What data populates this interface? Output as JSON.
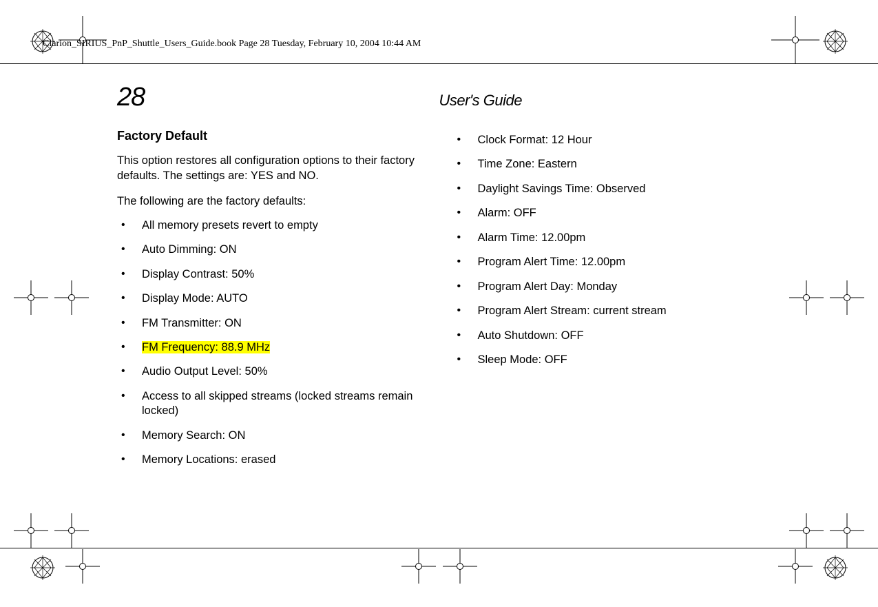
{
  "frame_path": "Clarion_SIRIUS_PnP_Shuttle_Users_Guide.book  Page 28  Tuesday, February 10, 2004  10:44 AM",
  "page_number": "28",
  "header_title": "User's Guide",
  "section_heading": "Factory Default",
  "paragraph_1": "This option restores all configuration options to their factory defaults. The settings are: YES and NO.",
  "paragraph_2": "The following are the factory defaults:",
  "left_list": [
    "All memory presets revert to empty",
    "Auto Dimming: ON",
    "Display Contrast: 50%",
    "Display Mode: AUTO",
    "FM Transmitter: ON",
    "FM Frequency: 88.9 MHz",
    "Audio Output Level: 50%",
    "Access to all skipped streams (locked streams remain locked)",
    "Memory Search: ON",
    "Memory Locations: erased"
  ],
  "right_list": [
    "Clock Format: 12 Hour",
    "Time Zone: Eastern",
    "Daylight Savings Time: Observed",
    "Alarm: OFF",
    "Alarm Time: 12.00pm",
    "Program Alert Time: 12.00pm",
    "Program Alert Day: Monday",
    "Program Alert Stream: current stream",
    "Auto Shutdown: OFF",
    "Sleep Mode: OFF"
  ],
  "highlight_index": 5
}
